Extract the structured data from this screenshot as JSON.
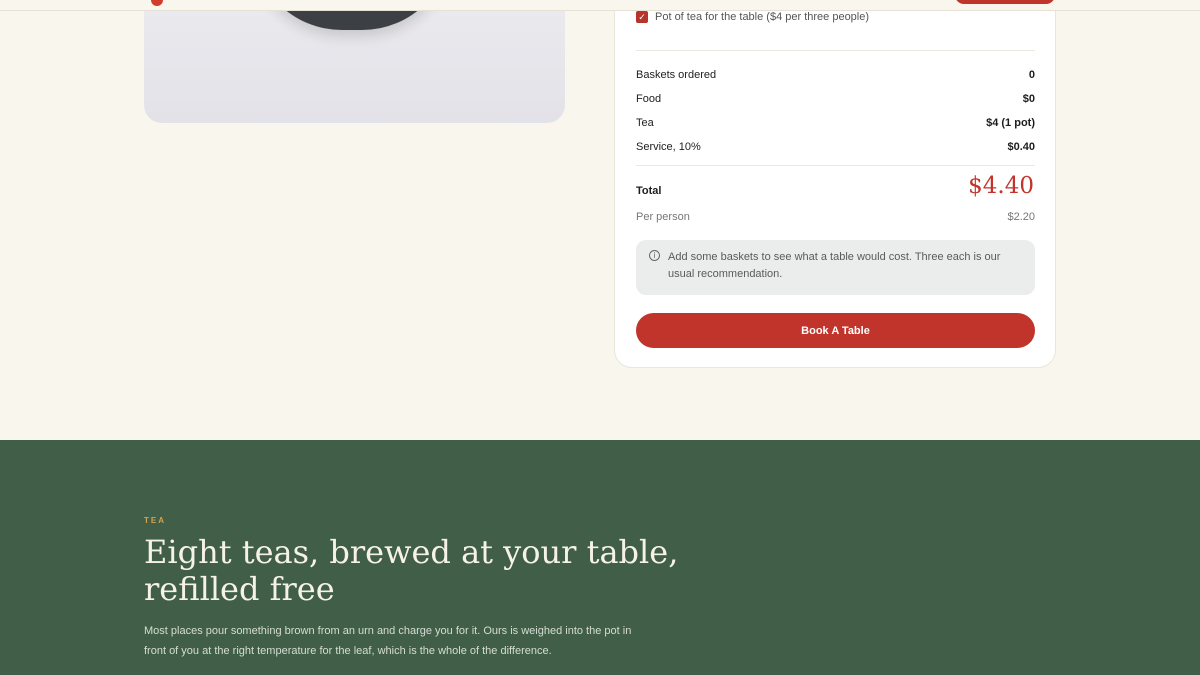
{
  "estimate": {
    "tea_option_label": "Pot of tea for the table ($4 per three people)",
    "rows": [
      {
        "label": "Baskets ordered",
        "value": "0"
      },
      {
        "label": "Food",
        "value": "$0"
      },
      {
        "label": "Tea",
        "value": "$4 (1 pot)"
      },
      {
        "label": "Service, 10%",
        "value": "$0.40"
      }
    ],
    "total_label": "Total",
    "total_value": "$4.40",
    "per_person_label": "Per person",
    "per_person_value": "$2.20",
    "notice_text": "Add some baskets to see what a table would cost. Three each is our usual recommendation.",
    "book_button_label": "Book A Table"
  },
  "tea_section": {
    "eyebrow": "TEA",
    "heading_line1": "Eight teas, brewed at your table,",
    "heading_line2": "refilled free",
    "body": "Most places pour something brown from an urn and charge you for it. Ours is weighed into the pot in front of you at the right temperature for the leaf, which is the whole of the difference."
  },
  "colors": {
    "accent": "#c0342b",
    "page_bg": "#f9f6ee",
    "tea_bg": "#405e48",
    "eyebrow": "#d6a24a"
  }
}
